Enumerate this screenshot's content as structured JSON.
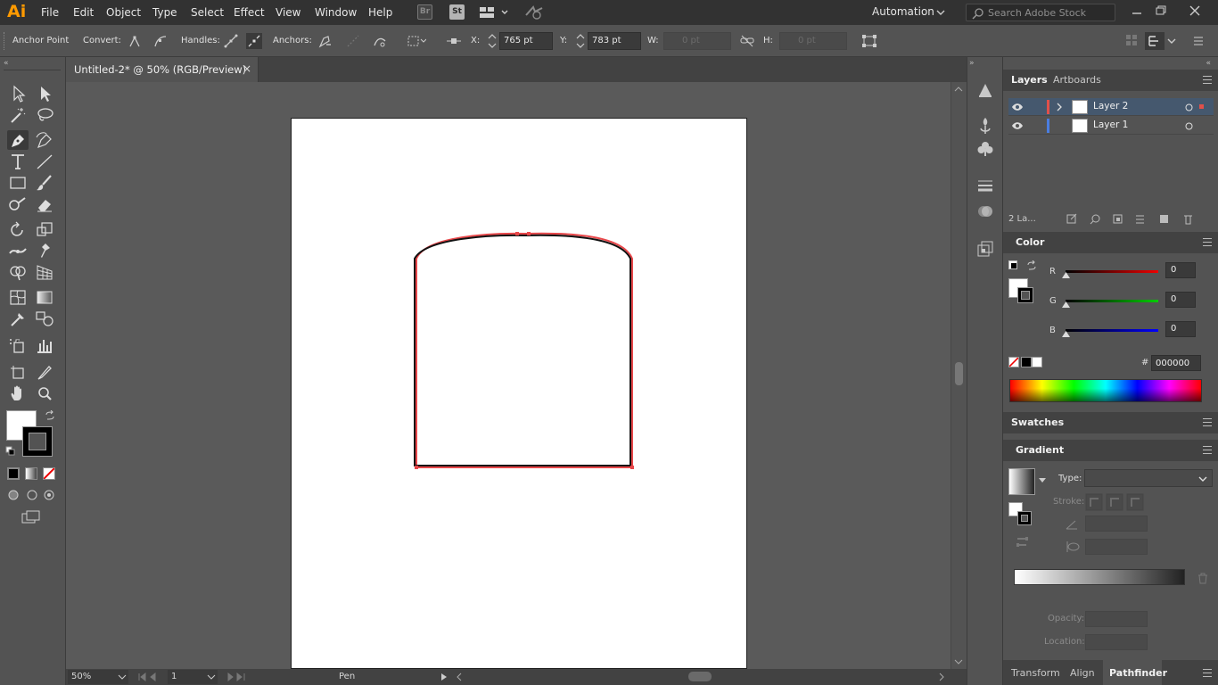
{
  "app": {
    "logo": "Ai"
  },
  "menu": [
    "File",
    "Edit",
    "Object",
    "Type",
    "Select",
    "Effect",
    "View",
    "Window",
    "Help"
  ],
  "topbar": {
    "bridge": "Br",
    "stock": "St",
    "workspace": "Automation",
    "search_placeholder": "Search Adobe Stock"
  },
  "control": {
    "tool_name": "Anchor Point",
    "convert_label": "Convert:",
    "handles_label": "Handles:",
    "anchors_label": "Anchors:",
    "x_label": "X:",
    "x_value": "765 pt",
    "y_label": "Y:",
    "y_value": "783 pt",
    "w_label": "W:",
    "w_value": "0 pt",
    "h_label": "H:",
    "h_value": "0 pt"
  },
  "document": {
    "tab_title": "Untitled-2* @ 50% (RGB/Preview)",
    "close": "×"
  },
  "status": {
    "zoom": "50%",
    "page": "1",
    "tool": "Pen"
  },
  "layers_panel": {
    "tabs": [
      "Layers",
      "Artboards"
    ],
    "layers": [
      {
        "name": "Layer 2",
        "color": "#e0504a",
        "selected": true
      },
      {
        "name": "Layer 1",
        "color": "#4a7de0",
        "selected": false
      }
    ],
    "count": "2 La..."
  },
  "color_panel": {
    "title": "Color",
    "r_label": "R",
    "r_value": "0",
    "g_label": "G",
    "g_value": "0",
    "b_label": "B",
    "b_value": "0",
    "hex_label": "#",
    "hex_value": "000000"
  },
  "swatches_panel": {
    "title": "Swatches"
  },
  "gradient_panel": {
    "title": "Gradient",
    "type_label": "Type:",
    "stroke_label": "Stroke:",
    "opacity_label": "Opacity:",
    "location_label": "Location:"
  },
  "bottom_tabs": [
    "Transform",
    "Align",
    "Pathfinder"
  ],
  "colors": {
    "path": "#e8474a",
    "panel": "#535353",
    "dark": "#323232"
  }
}
